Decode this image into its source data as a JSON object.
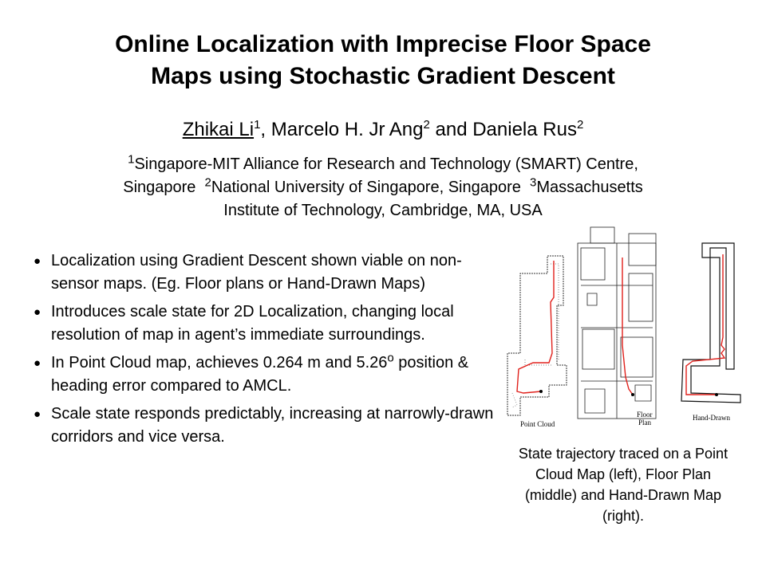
{
  "title": {
    "line1": "Online Localization with Imprecise Floor Space",
    "line2": "Maps using Stochastic Gradient Descent"
  },
  "authors": {
    "a1_name": "Zhikai Li",
    "a1_sup": "1",
    "a2_name": ", Marcelo H. Jr Ang",
    "a2_sup": "2",
    "a3_name": " and Daniela Rus",
    "a3_sup": "2"
  },
  "affiliations": {
    "sup1": "1",
    "text1": "Singapore-MIT Alliance for Research and Technology (SMART) Centre,",
    "text2a": "Singapore  ",
    "sup2": "2",
    "text2b": "National University of Singapore, Singapore  ",
    "sup3": "3",
    "text2c": "Massachusetts",
    "text3": "Institute of Technology, Cambridge, MA, USA"
  },
  "bullets": [
    "Localization using Gradient Descent shown viable on non-sensor maps. (Eg. Floor plans or Hand-Drawn Maps)",
    "Introduces scale state for 2D Localization, changing local resolution of map in agent’s immediate surroundings.",
    "In Point Cloud map, achieves 0.264 m and 5.26",
    "Scale state responds predictably, increasing at narrowly-drawn corridors and vice versa."
  ],
  "bullet3": {
    "before": "In Point Cloud map, achieves 0.264 m and 5.26",
    "sup": "o",
    "after": " position & heading error compared to AMCL."
  },
  "figure": {
    "label_left": "Point Cloud",
    "label_middle_1": "Floor",
    "label_middle_2": "Plan",
    "label_right": "Hand-Drawn",
    "trajectory_color": "#e0201b"
  },
  "caption": "State trajectory traced on a Point Cloud Map (left), Floor Plan (middle) and Hand-Drawn Map (right)."
}
